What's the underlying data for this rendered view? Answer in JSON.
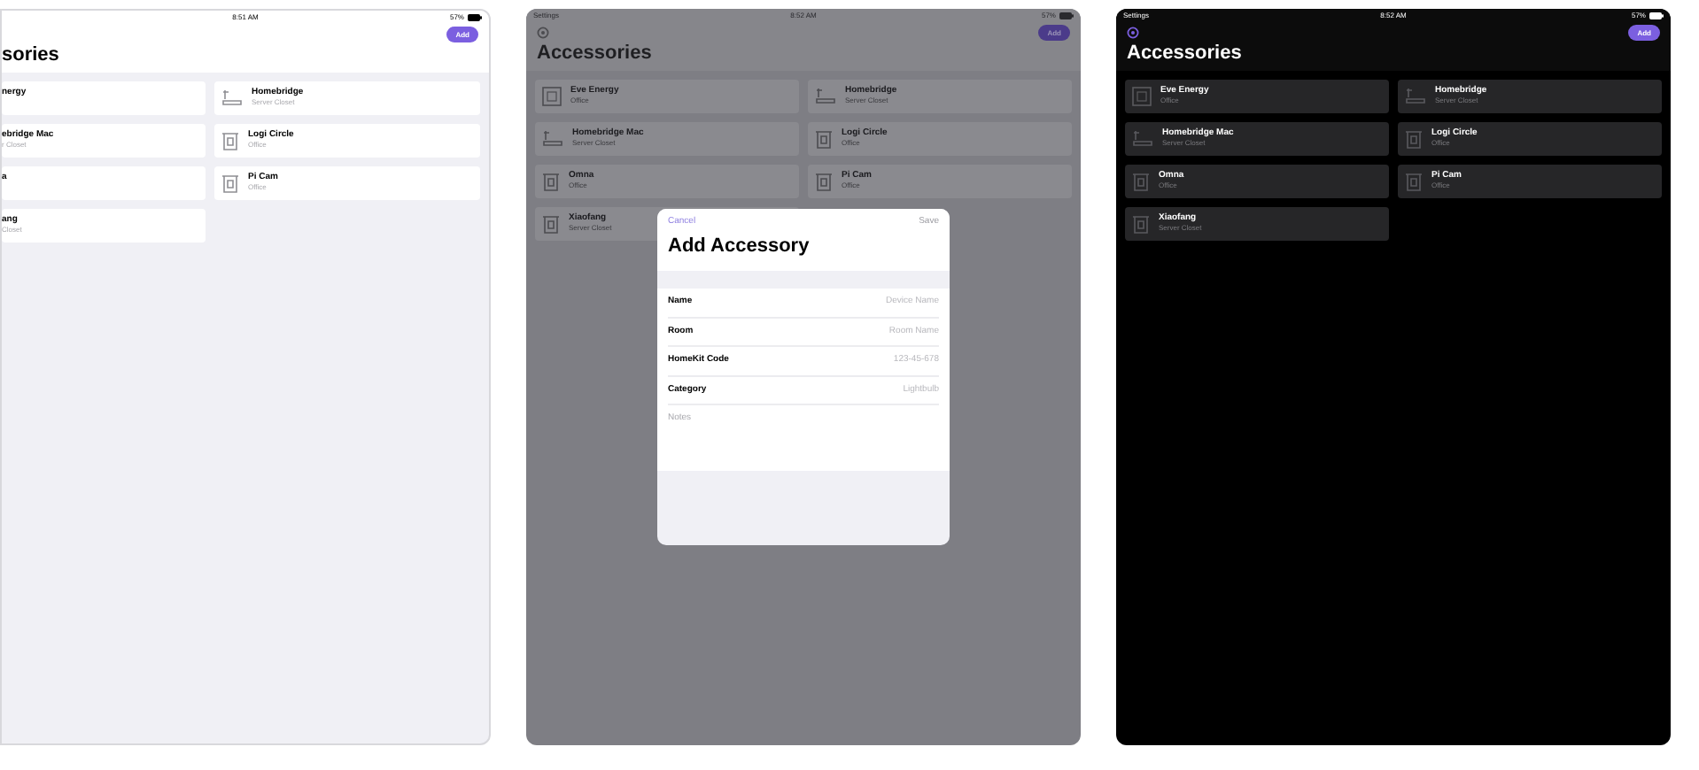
{
  "screenshots": [
    {
      "kind": "light",
      "status_bar": {
        "time": "8:51 AM",
        "battery": "57%"
      },
      "add_button": "Add",
      "title": "sories",
      "cards": [
        {
          "name": "nergy"
        },
        {
          "name": "Homebridge",
          "subtitle": "Server Closet",
          "kind": "server"
        },
        {
          "name": "ebridge Mac",
          "subtitle": "r Closet"
        },
        {
          "name": "Logi Circle",
          "subtitle": "Office",
          "kind": "box"
        },
        {
          "name": "a"
        },
        {
          "name": "Pi Cam",
          "subtitle": "Office",
          "kind": "box"
        },
        {
          "name": "ang",
          "subtitle": "Closet"
        }
      ]
    },
    {
      "kind": "dimmed",
      "status_bar": {
        "carrier": "Settings",
        "time": "8:52 AM",
        "battery": "57%"
      },
      "add_button": "Add",
      "title": "Accessories",
      "cards": [
        {
          "name": "Eve Energy",
          "subtitle": "Office",
          "kind": "outlet"
        },
        {
          "name": "Homebridge",
          "subtitle": "Server Closet",
          "kind": "server"
        },
        {
          "name": "Homebridge Mac",
          "subtitle": "Server Closet",
          "kind": "server"
        },
        {
          "name": "Logi Circle",
          "subtitle": "Office",
          "kind": "box"
        },
        {
          "name": "Omna",
          "subtitle": "Office",
          "kind": "box"
        },
        {
          "name": "Pi Cam",
          "subtitle": "Office",
          "kind": "box"
        },
        {
          "name": "Xiaofang",
          "subtitle": "Server Closet",
          "kind": "box"
        }
      ],
      "modal": {
        "cancel": "Cancel",
        "save": "Save",
        "save_disabled": true,
        "title": "Add Accessory",
        "fields": [
          {
            "label": "Name",
            "placeholder": "Device Name"
          },
          {
            "label": "Room",
            "placeholder": "Room Name"
          },
          {
            "label": "HomeKit Code",
            "placeholder": "123-45-678"
          },
          {
            "label": "Category",
            "placeholder": "Lightbulb"
          }
        ],
        "notes_placeholder": "Notes"
      }
    },
    {
      "kind": "dark",
      "status_bar": {
        "carrier": "Settings",
        "time": "8:52 AM",
        "battery": "57%"
      },
      "add_button": "Add",
      "title": "Accessories",
      "cards": [
        {
          "name": "Eve Energy",
          "subtitle": "Office",
          "kind": "outlet"
        },
        {
          "name": "Homebridge",
          "subtitle": "Server Closet",
          "kind": "server"
        },
        {
          "name": "Homebridge Mac",
          "subtitle": "Server Closet",
          "kind": "server"
        },
        {
          "name": "Logi Circle",
          "subtitle": "Office",
          "kind": "box"
        },
        {
          "name": "Omna",
          "subtitle": "Office",
          "kind": "box"
        },
        {
          "name": "Pi Cam",
          "subtitle": "Office",
          "kind": "box"
        },
        {
          "name": "Xiaofang",
          "subtitle": "Server Closet",
          "kind": "box"
        }
      ]
    }
  ]
}
